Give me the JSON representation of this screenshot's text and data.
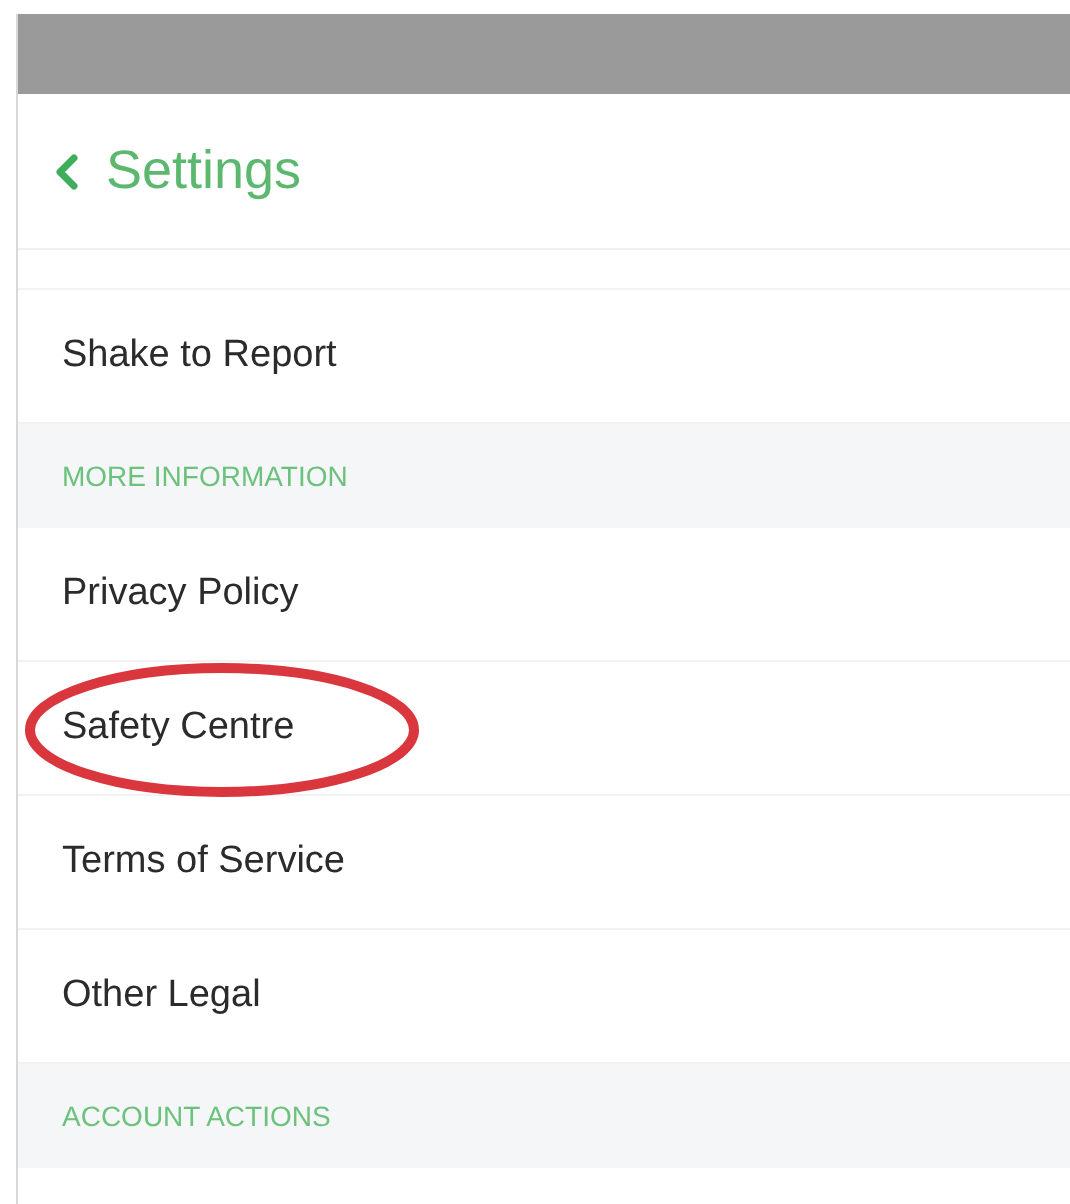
{
  "header": {
    "title": "Settings"
  },
  "items": [
    {
      "kind": "row",
      "label": "Shake to Report",
      "circled": false
    },
    {
      "kind": "section",
      "label": "MORE INFORMATION"
    },
    {
      "kind": "row",
      "label": "Privacy Policy",
      "circled": false
    },
    {
      "kind": "row",
      "label": "Safety Centre",
      "circled": true
    },
    {
      "kind": "row",
      "label": "Terms of Service",
      "circled": false
    },
    {
      "kind": "row",
      "label": "Other Legal",
      "circled": false
    },
    {
      "kind": "section",
      "label": "ACCOUNT ACTIONS"
    }
  ]
}
